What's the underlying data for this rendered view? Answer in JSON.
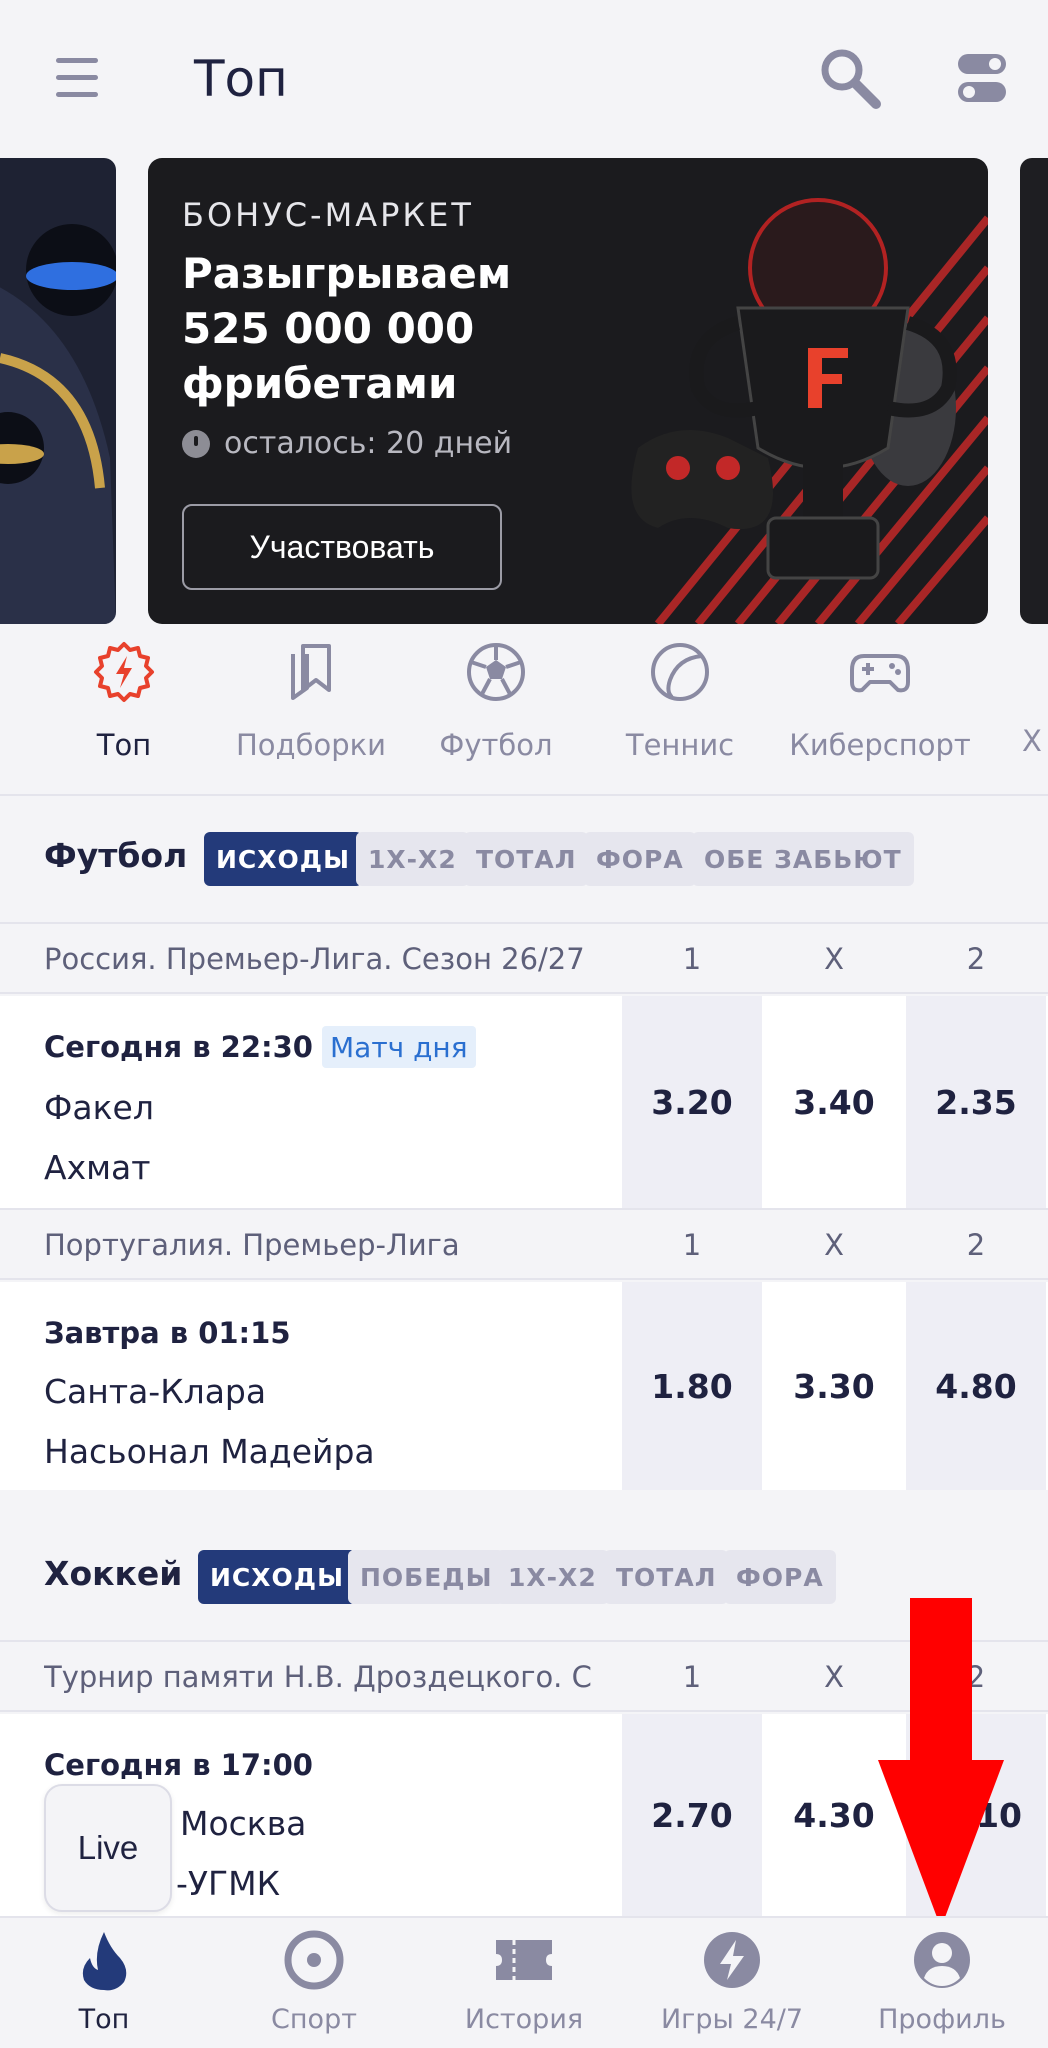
{
  "header": {
    "title": "Топ"
  },
  "banner": {
    "kicker": "БОНУС-МАРКЕТ",
    "title": "Разыгрываем 525 000 000 фрибетами",
    "timer": "осталось: 20 дней",
    "button": "Участвовать"
  },
  "categories": [
    {
      "label": "Топ",
      "icon": "flash-gear-icon",
      "active": true
    },
    {
      "label": "Подборки",
      "icon": "bookmarks-icon"
    },
    {
      "label": "Футбол",
      "icon": "soccer-ball-icon"
    },
    {
      "label": "Теннис",
      "icon": "tennis-ball-icon"
    },
    {
      "label": "Киберспорт",
      "icon": "gamepad-icon"
    },
    {
      "label": "Х"
    }
  ],
  "football": {
    "title": "Футбол",
    "chips": [
      "ИСХОДЫ",
      "1Х-Х2",
      "ТОТАЛ",
      "ФОРА",
      "ОБЕ ЗАБЬЮТ"
    ],
    "leagues": [
      {
        "name": "Россия. Премьер-Лига. Сезон 26/27",
        "cols": [
          "1",
          "X",
          "2"
        ],
        "match": {
          "time": "Сегодня в 22:30",
          "badge": "Матч дня",
          "team1": "Факел",
          "team2": "Ахмат",
          "odds": [
            "3.20",
            "3.40",
            "2.35"
          ]
        }
      },
      {
        "name": "Португалия. Премьер-Лига",
        "cols": [
          "1",
          "X",
          "2"
        ],
        "match": {
          "time": "Завтра в 01:15",
          "team1": "Санта-Клара",
          "team2": "Насьонал Мадейра",
          "odds": [
            "1.80",
            "3.30",
            "4.80"
          ]
        }
      }
    ]
  },
  "hockey": {
    "title": "Хоккей",
    "chips": [
      "ИСХОДЫ",
      "ПОБЕДЫ",
      "1Х-Х2",
      "ТОТАЛ",
      "ФОРА"
    ],
    "leagues": [
      {
        "name": "Турнир памяти Н.В. Дроздецкого. С",
        "cols": [
          "1",
          "X",
          "2"
        ],
        "match": {
          "time": "Сегодня в 17:00",
          "team1": "Москва",
          "team2": "-УГМК",
          "odds": [
            "2.70",
            "4.30",
            "10"
          ]
        }
      }
    ]
  },
  "live_button": "Live",
  "bottom_nav": [
    {
      "label": "Топ",
      "icon": "flame-icon",
      "active": true
    },
    {
      "label": "Спорт",
      "icon": "target-icon"
    },
    {
      "label": "История",
      "icon": "ticket-icon"
    },
    {
      "label": "Игры 24/7",
      "icon": "lightning-circle-icon"
    },
    {
      "label": "Профиль",
      "icon": "user-icon"
    }
  ],
  "colors": {
    "accent_red": "#e8412c",
    "chip_active": "#233a7a",
    "text_dark": "#1f2240",
    "text_muted": "#8a8aa2",
    "badge_blue": "#2a6fd0",
    "arrow_red": "#ff0000"
  }
}
